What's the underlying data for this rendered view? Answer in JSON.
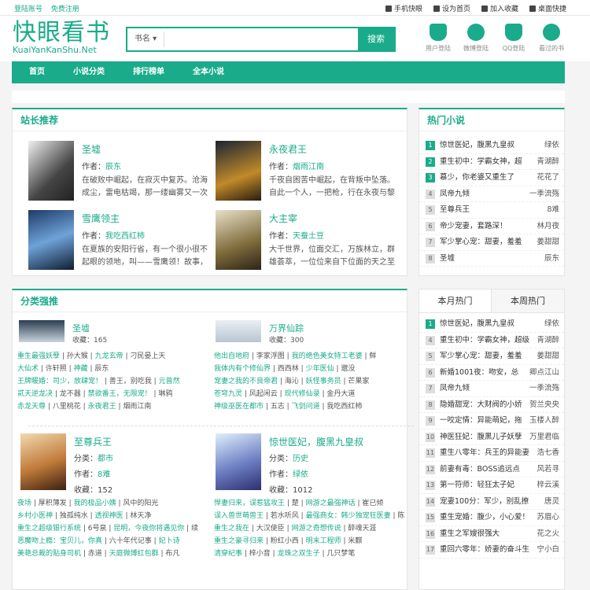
{
  "topbar": {
    "left": [
      "登陆账号",
      "免费注册"
    ],
    "right": [
      "手机快眼",
      "设为首页",
      "加入收藏",
      "桌面快捷"
    ]
  },
  "logo": {
    "cn": "快眼看书",
    "en": "KuaiYanKanShu.Net"
  },
  "search": {
    "category": "书名 ▾",
    "placeholder": "",
    "button": "搜索"
  },
  "header_icons": [
    "用户登陆",
    "微博登陆",
    "QQ登陆",
    "看过的书"
  ],
  "nav": [
    "首页",
    "小说分类",
    "排行榜单",
    "全本小说"
  ],
  "recommend": {
    "title": "站长推荐",
    "books": [
      {
        "title": "圣墟",
        "author_label": "作者：",
        "author": "辰东",
        "desc": "在破败中崛起，在寂灭中复苏。沧海成尘，雷电枯竭，那一缕幽雾又一次"
      },
      {
        "title": "永夜君王",
        "author_label": "作者：",
        "author": "烟雨江南",
        "desc": "千夜自困苦中崛起，在背叛中坠落。自此一个人，一把枪，行在永夜与黎"
      },
      {
        "title": "雪鹰领主",
        "author_label": "作者：",
        "author": "我吃西红柿",
        "desc": "在夏族的安阳行省，有一个很小很不起眼的领地，叫——雪鹰领！故事，"
      },
      {
        "title": "大主宰",
        "author_label": "作者：",
        "author": "天蚕土豆",
        "desc": "大千世界，位面交汇，万族林立，群雄荟萃，一位位来自下位面的天之至"
      }
    ]
  },
  "hot": {
    "title": "热门小说",
    "items": [
      {
        "n": "1",
        "title": "惊世医妃，腹黑九皇叔",
        "author": "绿依"
      },
      {
        "n": "2",
        "title": "重生初中：学霸女神，超",
        "author": "青湖醉"
      },
      {
        "n": "3",
        "title": "慕少，你老婆又重生了",
        "author": "花花了"
      },
      {
        "n": "4",
        "title": "凤帝九倾",
        "author": "一季流殇"
      },
      {
        "n": "5",
        "title": "至尊兵王",
        "author": "8难"
      },
      {
        "n": "6",
        "title": "帝少宠妻，套路深！",
        "author": "林月夜"
      },
      {
        "n": "7",
        "title": "军少掌心宠：甜妻，羞羞",
        "author": "姜甜甜"
      },
      {
        "n": "8",
        "title": "圣墟",
        "author": "辰东"
      }
    ]
  },
  "category": {
    "title": "分类强推",
    "blocks": [
      {
        "title": "圣墟",
        "sub": "收藏：165"
      },
      {
        "title": "万界仙踪",
        "sub": "收藏：300"
      }
    ],
    "links_left": [
      [
        "重生最强妖孽",
        "孙大猴",
        "九龙玄帝",
        "刁民晏上天"
      ],
      [
        "大仙术",
        "许轩照",
        "神藏",
        "辰东"
      ],
      [
        "王牌暖婚：司少，放肆宠！",
        "善王，别吃我",
        "元曾然"
      ],
      [
        "贰天逆龙决",
        "龙不器",
        "禁欲番王，无限宠！",
        "琳鸦"
      ],
      [
        "赤龙天尊",
        "八里桃花",
        "永夜君王",
        "烟雨江南"
      ]
    ],
    "links_right": [
      [
        "他出自地府",
        "李家浮图",
        "我的绝色美女特工老婆",
        "鲜"
      ],
      [
        "我体内有个修仙界",
        "西西林",
        "少年医仙",
        "邈没"
      ],
      [
        "宠妻之我的不良帝君",
        "海沁",
        "妖怪事务员",
        "芒果家"
      ],
      [
        "苍穹九灵",
        "风起闲云",
        "现代修仙录",
        "金丹大道"
      ],
      [
        "神级巫医在都市",
        "五志",
        "飞剑问道",
        "我吃西红柿"
      ]
    ],
    "books2": [
      {
        "title": "至尊兵王",
        "cat_label": "分类：",
        "cat": "都市",
        "author_label": "作者：",
        "author": "8难",
        "fav_label": "收藏：",
        "fav": "152"
      },
      {
        "title": "惊世医妃，腹黑九皇叔",
        "cat_label": "分类：",
        "cat": "历史",
        "author_label": "作者：",
        "author": "绿依",
        "fav_label": "收藏：",
        "fav": "1012"
      }
    ],
    "links_left2": [
      [
        "夜场",
        "厚积薄发",
        "我的极品小姨",
        "风中的阳光"
      ],
      [
        "乡村小医神",
        "独孤纯水",
        "透视神医",
        "林天净"
      ],
      [
        "重生之超级银行系统",
        "6号泉",
        "昆明，今夜你将遇见你",
        "续"
      ],
      [
        "恶魔吻上瘾：宝贝儿，你真",
        "六十年代记事",
        "妃卜诗"
      ],
      [
        "美艳总裁的贴身司机",
        "赤道",
        "天庭微博红包群",
        "布凡"
      ]
    ],
    "links_right2": [
      [
        "悍妻归来，误惹猛攻王",
        "楚",
        "网游之最强神话",
        "崔已倾"
      ],
      [
        "误入兽世萌兽王",
        "若水听风",
        "最强商女：韩少独宠狂医妻",
        "陈"
      ],
      [
        "重生之我在",
        "大汉使臣",
        "网游之奇想传说",
        "醉魂天涯"
      ],
      [
        "重生之豪寻归来",
        "粉红小西",
        "明末工程师",
        "米麒"
      ],
      [
        "清穿纪事",
        "梓小音",
        "龙珠之双生子",
        "几只梦笔"
      ]
    ]
  },
  "monthly": {
    "tabs": [
      "本月热门",
      "本周热门"
    ],
    "items": [
      {
        "n": "1",
        "title": "惊世医妃，腹黑九皇叔",
        "author": "绿依"
      },
      {
        "n": "4",
        "title": "重生初中：学霸女神，超级",
        "author": "青湖醉"
      },
      {
        "n": "5",
        "title": "军少掌心宠：甜妻，羞羞",
        "author": "姜甜甜"
      },
      {
        "n": "6",
        "title": "新婚1001夜：吻安，总",
        "author": "卿点江山"
      },
      {
        "n": "7",
        "title": "凤帝九倾",
        "author": "一季流殇"
      },
      {
        "n": "8",
        "title": "隐婚甜宠：大财阀的小娇",
        "author": "贺兰央央"
      },
      {
        "n": "9",
        "title": "一咬定情：异能萌妃，拖",
        "author": "玉楼人醉"
      },
      {
        "n": "10",
        "title": "神医狂妃：腹黑儿子妖孽",
        "author": "万里君临"
      },
      {
        "n": "11",
        "title": "重生八零年：兵王的异能妻",
        "author": "浩七香"
      },
      {
        "n": "12",
        "title": "前妻有毒：BOSS追远点",
        "author": "风若寻"
      },
      {
        "n": "13",
        "title": "第一符师：轻狂太子妃",
        "author": "梓云溪"
      },
      {
        "n": "14",
        "title": "宠妻100分：军少，别乱撩",
        "author": "唐灵"
      },
      {
        "n": "15",
        "title": "重生宠婚：腹少，小心爱！",
        "author": "苏眉心"
      },
      {
        "n": "16",
        "title": "重生之军嫂很强大",
        "author": "花之火"
      },
      {
        "n": "17",
        "title": "重回六零年：娇妻的奋斗生",
        "author": "宁小白"
      }
    ]
  }
}
